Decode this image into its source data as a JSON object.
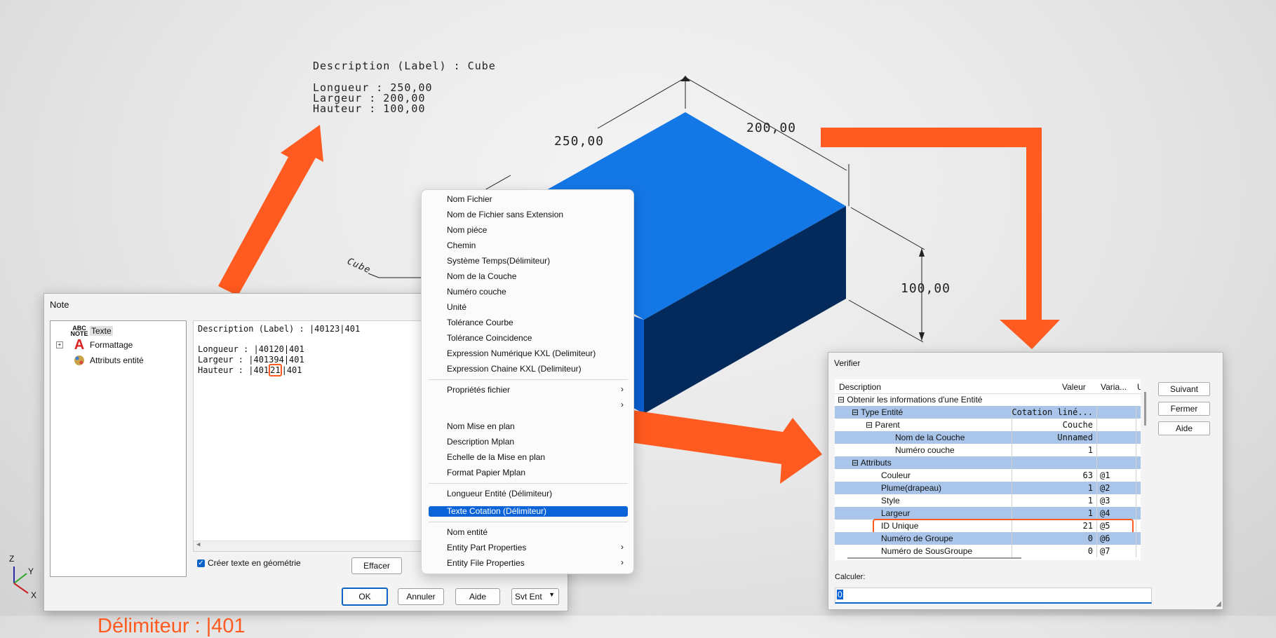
{
  "cad": {
    "label_lines": [
      "Description (Label) : Cube",
      "",
      "Longueur : 250,00",
      "Largeur : 200,00",
      "Hauteur : 100,00"
    ],
    "dim_length": "250,00",
    "dim_width": "200,00",
    "dim_height": "100,00",
    "leader_text": "Cube",
    "axes": {
      "z": "Z",
      "y": "Y",
      "x": "X"
    },
    "colors": {
      "top": "#1477e6",
      "front": "#0a5fd0",
      "side": "#032a5a",
      "arrow": "#ff5a1f"
    }
  },
  "annotation": {
    "delimiter_callout": "Délimiteur : |401"
  },
  "note_dialog": {
    "title": "Note",
    "tree": [
      {
        "icon": "ABC NOTE",
        "label": "Texte"
      },
      {
        "icon": "A",
        "label": "Formattage"
      },
      {
        "icon": "attr",
        "label": "Attributs entité"
      }
    ],
    "editor": {
      "line1_pre": "Description (Label) : |40123|401",
      "line3": "Longueur : |40120|401",
      "line4": "Largeur : |401394|401",
      "line5_pre": "Hauteur : |401",
      "line5_hl": "21",
      "line5_post": "|401"
    },
    "checkbox_label": "Créer texte en géométrie",
    "checkbox_checked": true,
    "effacer": "Effacer",
    "buttons": {
      "ok": "OK",
      "annuler": "Annuler",
      "aide": "Aide",
      "svt_ent": "Svt Ent"
    }
  },
  "context_menu": {
    "items": [
      {
        "label": "Nom Fichier"
      },
      {
        "label": "Nom de Fichier sans Extension"
      },
      {
        "label": "Nom piéce"
      },
      {
        "label": "Chemin"
      },
      {
        "label": "Système Temps(Délimiteur)"
      },
      {
        "label": "Nom de la Couche"
      },
      {
        "label": "Numéro couche"
      },
      {
        "label": "Unité"
      },
      {
        "label": "Tolérance Courbe"
      },
      {
        "label": "Tolérance Coincidence"
      },
      {
        "label": "Expression Numérique KXL (Delimiteur)"
      },
      {
        "label": "Expression Chaine KXL (Delimiteur)"
      },
      {
        "label": "Propriétés fichier",
        "submenu": true
      },
      {
        "label": "",
        "submenu": true
      },
      {
        "label": "Nom Mise en plan"
      },
      {
        "label": "Description Mplan"
      },
      {
        "label": "Echelle de la Mise en plan"
      },
      {
        "label": "Format Papier Mplan"
      },
      {
        "label": "Longueur Entité (Délimiteur)"
      },
      {
        "label": "Texte Cotation (Délimiteur)",
        "selected": true
      },
      {
        "label": "Nom entité"
      },
      {
        "label": "Entity Part Properties",
        "submenu": true
      },
      {
        "label": "Entity File Properties",
        "submenu": true
      }
    ]
  },
  "verifier": {
    "title": "Verifier",
    "columns": {
      "desc": "Description",
      "valeur": "Valeur",
      "varia": "Varia...",
      "u": "U"
    },
    "rows": [
      {
        "label": "Obtenir les informations d'une Entité",
        "value": "",
        "var": "",
        "hl": false
      },
      {
        "label": "Type Entité",
        "value": "Cotation liné...",
        "var": "",
        "hl": true
      },
      {
        "label": "Parent",
        "value": "Couche",
        "var": "",
        "hl": false
      },
      {
        "label": "Nom de la Couche",
        "value": "Unnamed",
        "var": "",
        "hl": true
      },
      {
        "label": "Numéro couche",
        "value": "1",
        "var": "",
        "hl": false
      },
      {
        "label": "Attributs",
        "value": "",
        "var": "",
        "hl": true
      },
      {
        "label": "Couleur",
        "value": "63",
        "var": "@1",
        "hl": false
      },
      {
        "label": "Plume(drapeau)",
        "value": "1",
        "var": "@2",
        "hl": true
      },
      {
        "label": "Style",
        "value": "1",
        "var": "@3",
        "hl": false
      },
      {
        "label": "Largeur",
        "value": "1",
        "var": "@4",
        "hl": true
      },
      {
        "label": "ID Unique",
        "value": "21",
        "var": "@5",
        "hl": false
      },
      {
        "label": "Numéro de Groupe",
        "value": "0",
        "var": "@6",
        "hl": true
      },
      {
        "label": "Numéro de SousGroupe",
        "value": "0",
        "var": "@7",
        "hl": false
      }
    ],
    "buttons": {
      "suivant": "Suivant",
      "fermer": "Fermer",
      "aide": "Aide"
    },
    "calculer_label": "Calculer:",
    "calculer_value": "0"
  }
}
